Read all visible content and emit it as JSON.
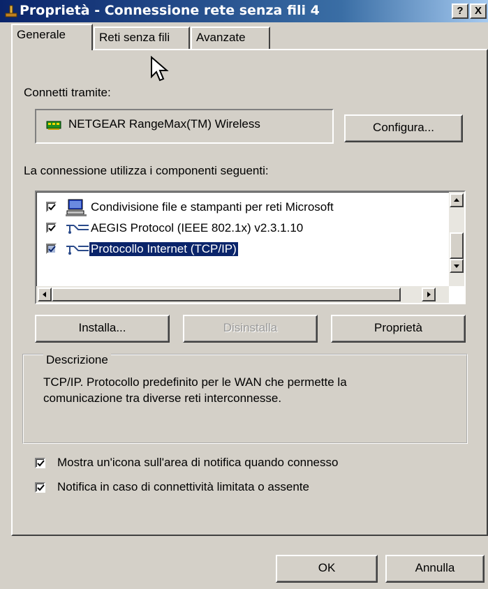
{
  "window": {
    "title": "Proprietà - Connessione rete senza fili 4",
    "help_button": "?",
    "close_button": "X"
  },
  "tabs": [
    {
      "label": "Generale",
      "active": true
    },
    {
      "label": "Reti senza fili",
      "active": false
    },
    {
      "label": "Avanzate",
      "active": false
    }
  ],
  "connect_using": {
    "label": "Connetti tramite:",
    "adapter": "NETGEAR RangeMax(TM) Wireless",
    "configure_button": "Configura..."
  },
  "components": {
    "label": "La connessione utilizza i componenti seguenti:",
    "items": [
      {
        "label": "Condivisione file e stampanti per reti Microsoft",
        "checked": true,
        "icon": "computer-network-icon",
        "selected": false
      },
      {
        "label": "AEGIS Protocol (IEEE 802.1x) v2.3.1.10",
        "checked": true,
        "icon": "protocol-icon",
        "selected": false
      },
      {
        "label": "Protocollo Internet (TCP/IP)",
        "checked": true,
        "icon": "protocol-icon",
        "selected": true
      }
    ]
  },
  "buttons": {
    "install": "Installa...",
    "uninstall": "Disinstalla",
    "properties": "Proprietà"
  },
  "description": {
    "legend": "Descrizione",
    "line1": "TCP/IP. Protocollo predefinito per le WAN che permette la",
    "line2": "comunicazione tra diverse reti interconnesse."
  },
  "options": [
    {
      "label": "Mostra un'icona sull'area di notifica quando connesso",
      "checked": true
    },
    {
      "label": "Notifica in caso di connettività limitata o assente",
      "checked": true
    }
  ],
  "footer": {
    "ok": "OK",
    "cancel": "Annulla"
  },
  "colors": {
    "title_bar": "#0a246a",
    "selection": "#0a246a",
    "face": "#d4d0c8"
  }
}
